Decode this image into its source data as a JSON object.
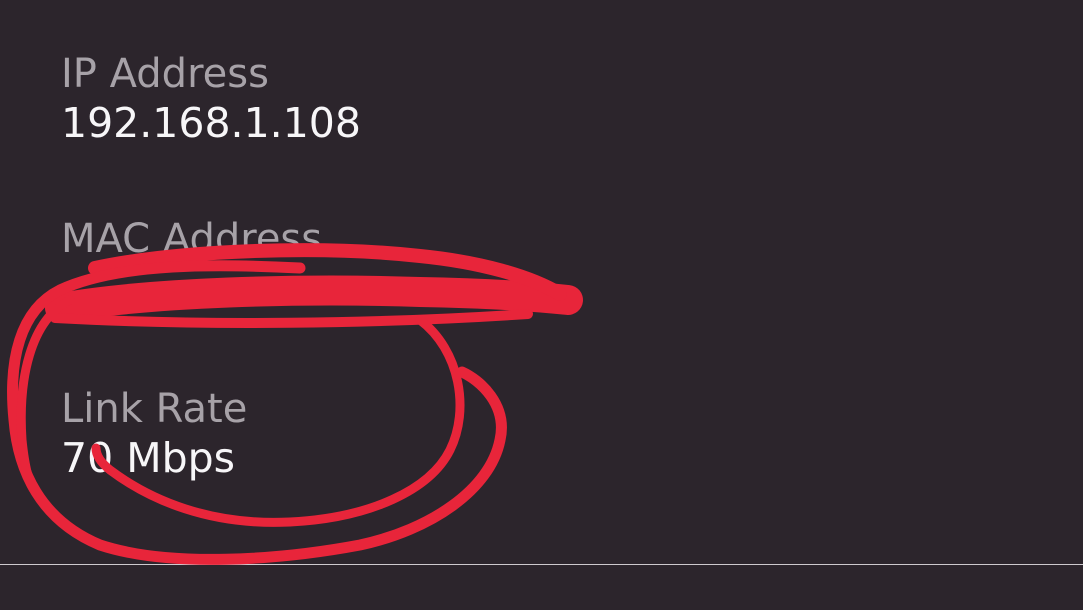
{
  "network_info": {
    "ip_address": {
      "label": "IP Address",
      "value": "192.168.1.108"
    },
    "mac_address": {
      "label": "MAC Address",
      "value": ""
    },
    "link_rate": {
      "label": "Link Rate",
      "value": "70 Mbps"
    }
  },
  "annotation": {
    "color": "#e8253a"
  }
}
